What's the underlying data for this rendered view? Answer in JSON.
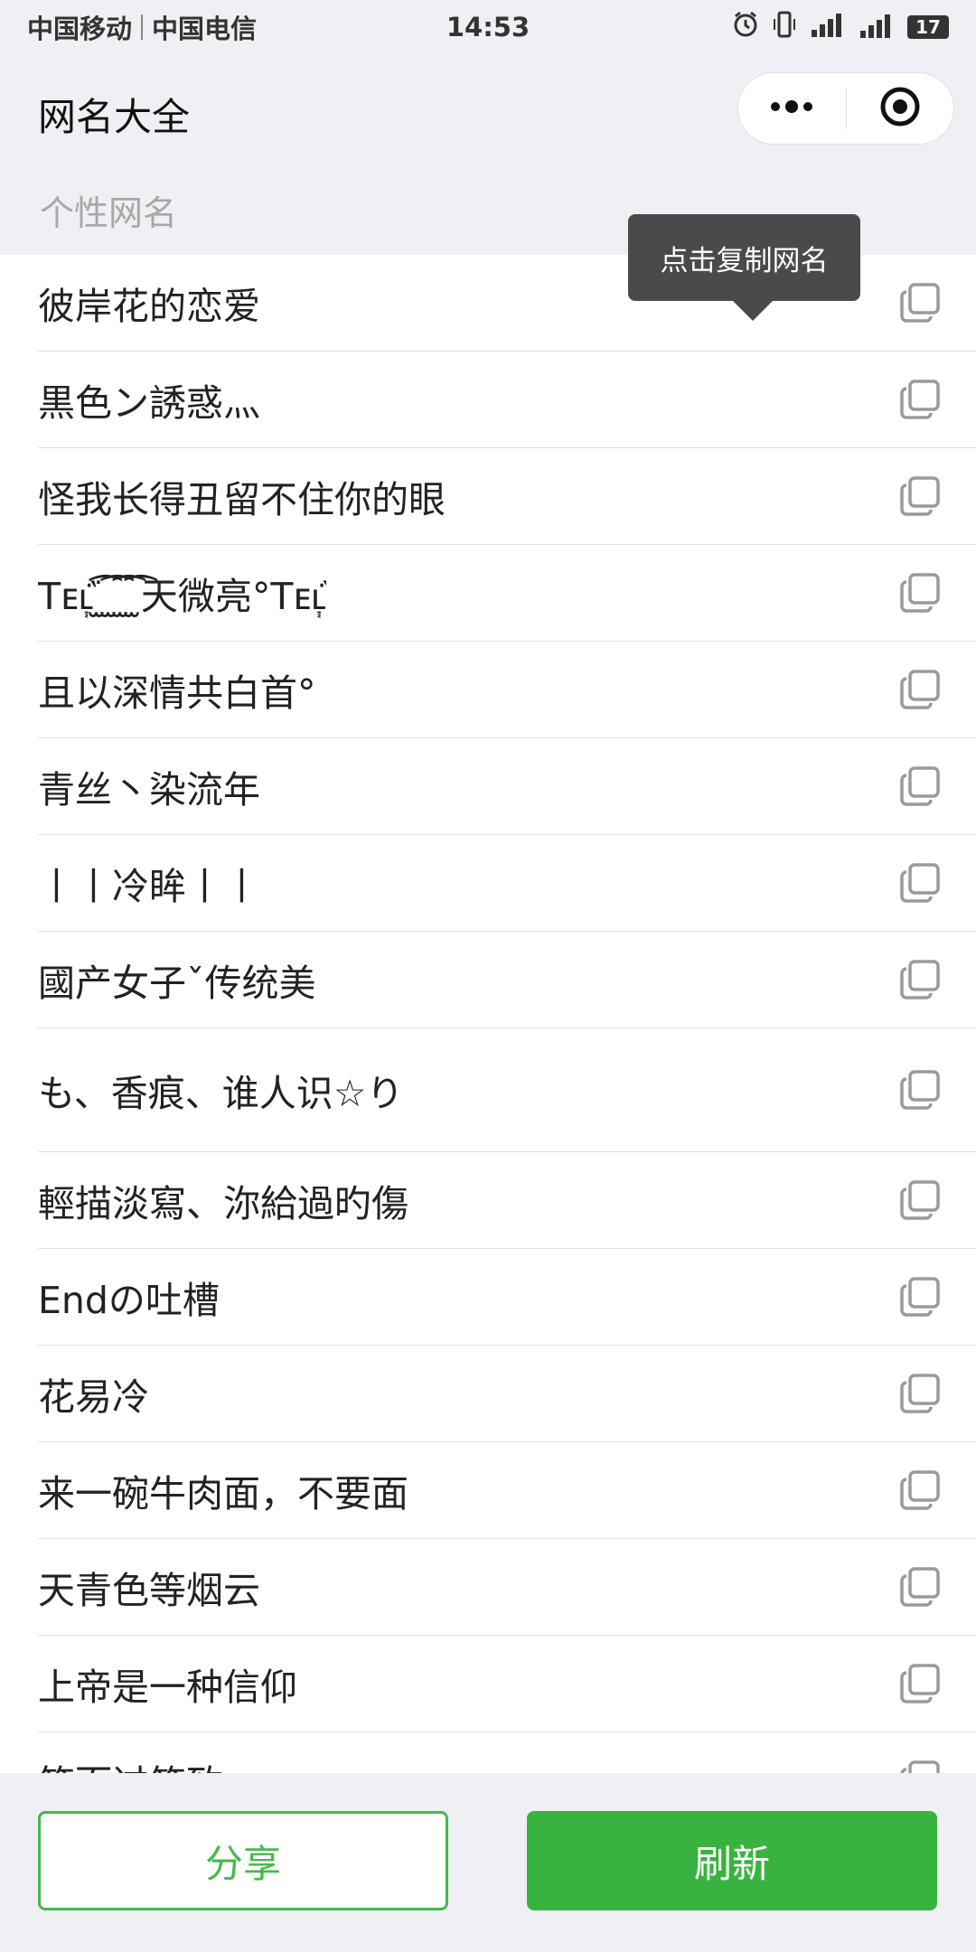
{
  "status_bar": {
    "carrier1": "中国移动",
    "carrier2": "中国电信",
    "time": "14:53",
    "battery": "17",
    "icons": [
      "alarm-icon",
      "vibrate-icon",
      "signal-icon",
      "signal-4g-icon",
      "battery-icon"
    ]
  },
  "nav": {
    "title": "网名大全",
    "more_icon": "more-dots-icon",
    "close_icon": "target-close-icon"
  },
  "section_header": "个性网名",
  "tooltip": "点击复制网名",
  "items": [
    {
      "name": "彼岸花的恋爱"
    },
    {
      "name": "黒色ン誘惑灬"
    },
    {
      "name": "怪我长得丑留不住你的眼"
    },
    {
      "name": "Tᴇʟ᷂᷀ ̫͡ ̫͡ ̫͡ ̫͡天微亮°Tᴇʟ᷂᷀"
    },
    {
      "name": "且以深情共白首°"
    },
    {
      "name": "青丝丶染流年"
    },
    {
      "name": "丨丨冷眸丨丨"
    },
    {
      "name": "國产女子ˇ传统美"
    },
    {
      "name": "も、香痕、谁人识☆り"
    },
    {
      "name": "輕描淡寫、沵給過旳傷"
    },
    {
      "name": "Endの吐槽"
    },
    {
      "name": "花易冷"
    },
    {
      "name": "来一碗牛肉面，不要面"
    },
    {
      "name": "天青色等烟云"
    },
    {
      "name": "上帝是一种信仰"
    },
    {
      "name": "笑而过笑致"
    }
  ],
  "buttons": {
    "share": "分享",
    "refresh": "刷新"
  },
  "colors": {
    "accent": "#39b33f",
    "background": "#efeff4"
  }
}
